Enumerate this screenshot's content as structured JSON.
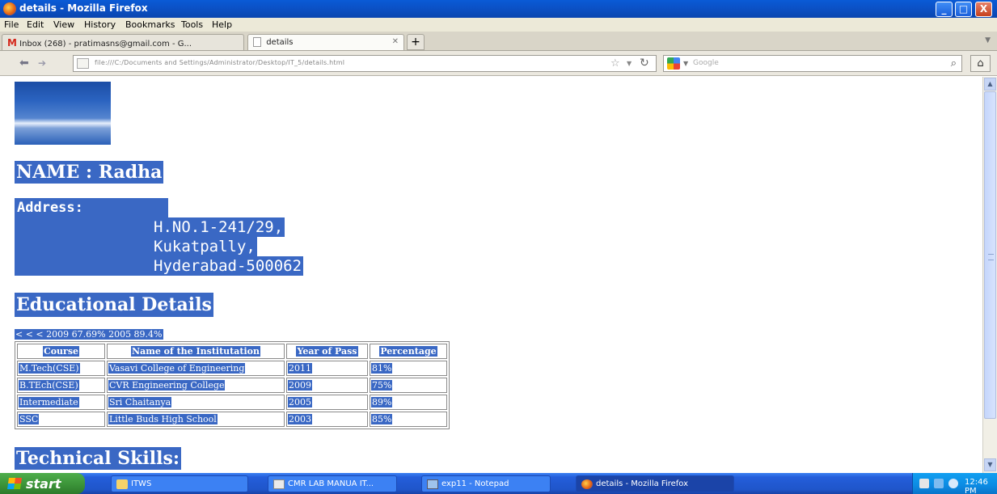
{
  "window": {
    "title": "details - Mozilla Firefox",
    "controls": [
      "_",
      "□",
      "X"
    ]
  },
  "menubar": [
    "File",
    "Edit",
    "View",
    "History",
    "Bookmarks",
    "Tools",
    "Help"
  ],
  "tabs": [
    {
      "label": "Inbox (268) - pratimasns@gmail.com - G...",
      "active": false
    },
    {
      "label": "details",
      "active": true
    }
  ],
  "nav": {
    "url": "file:///C:/Documents and Settings/Administrator/Desktop/IT_5/details.html",
    "search_placeholder": "Google"
  },
  "page": {
    "name_heading": "NAME : Radha",
    "address_label": "Address:",
    "address_lines": [
      "H.NO.1-241/29,",
      "Kukatpally,",
      "Hyderabad-500062"
    ],
    "edu_heading": "Educational Details",
    "stray_text": "< < < 2009 67.69% 2005 89.4%",
    "table": {
      "headers": [
        "Course",
        "Name of the Institutation",
        "Year of Pass",
        "Percentage"
      ],
      "rows": [
        [
          "M.Tech(CSE)",
          "Vasavi College of Engineering",
          "2011",
          "81%"
        ],
        [
          "B.TEch(CSE)",
          "CVR Engineering College",
          "2009",
          "75%"
        ],
        [
          "Intermediate",
          "Sri Chaitanya",
          "2005",
          "89%"
        ],
        [
          "SSC",
          "Little Buds High School",
          "2003",
          "85%"
        ]
      ]
    },
    "tech_heading": "Technical Skills:"
  },
  "taskbar": {
    "start": "start",
    "tasks": [
      "ITWS",
      "CMR LAB MANUA IT...",
      "exp11 - Notepad",
      "details - Mozilla Firefox"
    ],
    "clock": "12:46 PM"
  },
  "colors": {
    "highlight": "#3a68c4",
    "titlebar": "#0b4fc2",
    "taskbar": "#245edb"
  }
}
